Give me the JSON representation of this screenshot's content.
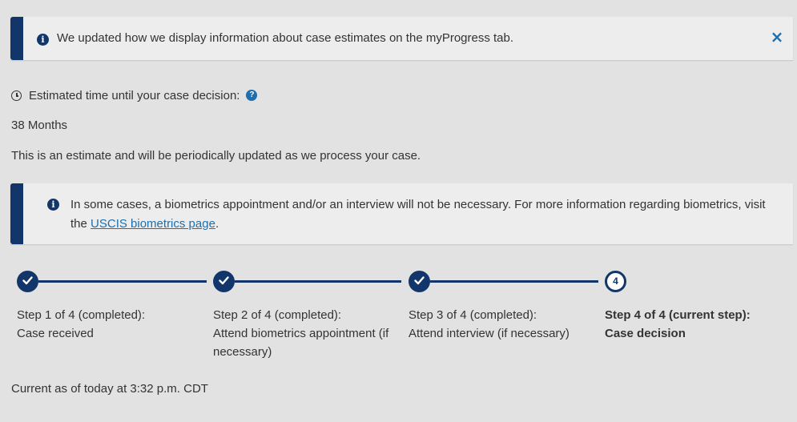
{
  "banner": {
    "icon": "info-icon",
    "text": "We updated how we display information about case estimates on the myProgress tab.",
    "close_label": "×",
    "accent_color": "#13366a",
    "close_color": "#1c6fb0"
  },
  "estimate": {
    "label": "Estimated time until your case decision:",
    "duration": "38 Months",
    "note": "This is an estimate and will be periodically updated as we process your case.",
    "help_icon": "question-icon",
    "clock_icon": "clock-icon"
  },
  "biometrics_alert": {
    "text_before": "In some cases, a biometrics appointment and/or an interview will not be necessary. For more information regarding biometrics, visit the ",
    "link_text": "USCIS biometrics page",
    "text_after": "."
  },
  "steps": [
    {
      "status": "completed",
      "heading": "Step 1 of 4 (completed):",
      "title": "Case received"
    },
    {
      "status": "completed",
      "heading": "Step 2 of 4 (completed):",
      "title": "Attend biometrics appointment (if necessary)"
    },
    {
      "status": "completed",
      "heading": "Step 3 of 4 (completed):",
      "title": "Attend interview (if necessary)"
    },
    {
      "status": "current",
      "number": "4",
      "heading": "Step 4 of 4 (current step):",
      "title": "Case decision"
    }
  ],
  "footer": {
    "updated": "Current as of today at 3:32 p.m. CDT"
  }
}
